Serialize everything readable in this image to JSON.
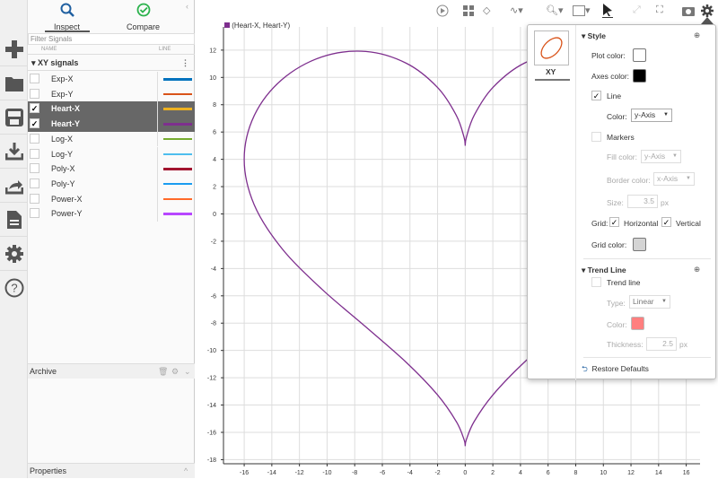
{
  "sidebar_icons": [
    "plus-icon",
    "folder-icon",
    "save-icon",
    "download-icon",
    "share-icon",
    "document-icon",
    "gear-icon",
    "help-icon"
  ],
  "tabs": [
    {
      "label": "Inspect",
      "active": true
    },
    {
      "label": "Compare",
      "active": false
    }
  ],
  "filter_placeholder": "Filter Signals",
  "columns": {
    "name": "NAME",
    "line": "LINE"
  },
  "group": "XY signals",
  "signals": [
    {
      "name": "Exp-X",
      "checked": false,
      "color": "#0072bd"
    },
    {
      "name": "Exp-Y",
      "checked": false,
      "color": "#d95319"
    },
    {
      "name": "Heart-X",
      "checked": true,
      "color": "#edb120"
    },
    {
      "name": "Heart-Y",
      "checked": true,
      "color": "#7e2f8e"
    },
    {
      "name": "Log-X",
      "checked": false,
      "color": "#77ac30"
    },
    {
      "name": "Log-Y",
      "checked": false,
      "color": "#4dbeee"
    },
    {
      "name": "Poly-X",
      "checked": false,
      "color": "#a2142f"
    },
    {
      "name": "Poly-Y",
      "checked": false,
      "color": "#1a9cf0"
    },
    {
      "name": "Power-X",
      "checked": false,
      "color": "#ff6929"
    },
    {
      "name": "Power-Y",
      "checked": false,
      "color": "#b746ff"
    }
  ],
  "archive": "Archive",
  "properties": "Properties",
  "toolbar_icons": [
    "play-icon",
    "layout-icon",
    "eraser-icon",
    "signal-icon",
    "zoom-icon",
    "fit-icon",
    "cursor-icon",
    "expand-icon",
    "fullscreen-icon",
    "camera-icon",
    "settings-icon"
  ],
  "popup": {
    "tab": "XY",
    "style_header": "Style",
    "plot_color_label": "Plot color:",
    "plot_color": "#ffffff",
    "axes_color_label": "Axes color:",
    "axes_color": "#000000",
    "line_label": "Line",
    "line_checked": true,
    "line_color_label": "Color:",
    "line_color": "y-Axis",
    "markers_label": "Markers",
    "markers_checked": false,
    "fill_color_label": "Fill color:",
    "fill_color": "y-Axis",
    "border_color_label": "Border color:",
    "border_color": "x-Axis",
    "size_label": "Size:",
    "size": "3.5",
    "size_unit": "px",
    "grid_label": "Grid:",
    "horizontal_label": "Horizontal",
    "vertical_label": "Vertical",
    "grid_h": true,
    "grid_v": true,
    "grid_color_label": "Grid color:",
    "grid_color": "#d4d4d4",
    "trend_header": "Trend Line",
    "trend_label": "Trend line",
    "trend_checked": false,
    "type_label": "Type:",
    "type": "Linear",
    "trend_color_label": "Color:",
    "trend_color": "#ff7f7f",
    "thickness_label": "Thickness:",
    "thickness": "2.5",
    "thickness_unit": "px",
    "restore": "Restore Defaults"
  },
  "chart_data": {
    "type": "line",
    "legend": "(Heart-X, Heart-Y)",
    "color": "#7e2f8e",
    "grid": true,
    "xlim": [
      -17.5,
      17
    ],
    "ylim": [
      -18.3,
      13.7
    ],
    "xticks": [
      -16,
      -14,
      -12,
      -10,
      -8,
      -6,
      -4,
      -2,
      0,
      2,
      4,
      6,
      8,
      10,
      12,
      14,
      16
    ],
    "yticks": [
      12,
      10,
      8,
      6,
      4,
      2,
      0,
      -2,
      -4,
      -6,
      -8,
      -10,
      -12,
      -14,
      -16,
      -18
    ],
    "series": [
      {
        "x": [
          0,
          0.084,
          0.64,
          2,
          4.25,
          7.19,
          10.39,
          13.28,
          15.28,
          16,
          15.28,
          13.28,
          10.39,
          7.19,
          4.25,
          2,
          0.64,
          0.084,
          0,
          -0.084,
          -0.64,
          -2,
          -4.25,
          -7.19,
          -10.39,
          -13.28,
          -15.28,
          -16,
          -15.28,
          -13.28,
          -10.39,
          -7.19,
          -4.25,
          -2,
          -0.64,
          -0.084,
          0
        ],
        "y": [
          5,
          5.61,
          7.21,
          9.26,
          11.03,
          11.9,
          11.5,
          9.83,
          7.19,
          4,
          0.68,
          -2.52,
          -5.5,
          -8.28,
          -10.89,
          -13.26,
          -15.22,
          -16.53,
          -17,
          -16.53,
          -15.22,
          -13.26,
          -10.89,
          -8.28,
          -5.5,
          -2.52,
          0.68,
          4,
          7.19,
          9.83,
          11.5,
          11.9,
          11.03,
          9.26,
          7.21,
          5.61,
          5
        ]
      }
    ]
  }
}
